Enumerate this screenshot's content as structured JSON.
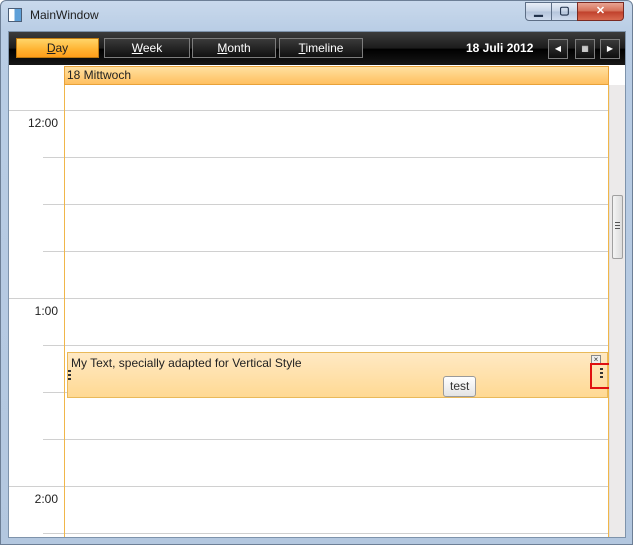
{
  "window": {
    "title": "MainWindow",
    "min_glyph": "▁",
    "max_glyph": "▢",
    "close_glyph": "✕"
  },
  "toolbar": {
    "views": [
      {
        "label": "Day",
        "accel": "D",
        "rest": "ay",
        "active": true
      },
      {
        "label": "Week",
        "accel": "W",
        "rest": "eek",
        "active": false
      },
      {
        "label": "Month",
        "accel": "M",
        "rest": "onth",
        "active": false
      },
      {
        "label": "Timeline",
        "accel": "T",
        "rest": "imeline",
        "active": false
      }
    ],
    "date": "18 Juli 2012",
    "prev_glyph": "◀",
    "calendar_glyph": "▦",
    "next_glyph": "▶"
  },
  "calendar": {
    "day_header": "18 Mittwoch",
    "time_labels": [
      "12:00",
      "1:00",
      "2:00"
    ],
    "appointment": {
      "text": "My Text, specially adapted for Vertical Style",
      "close_glyph": "×"
    },
    "tooltip": "test"
  },
  "colors": {
    "accent": "#ffb230",
    "highlight": "#e01010",
    "toolbar": "#1b1b1b"
  },
  "icons": [
    "app-window-icon",
    "minimize-icon",
    "maximize-icon",
    "close-icon",
    "previous-icon",
    "calendar-icon",
    "next-icon"
  ]
}
